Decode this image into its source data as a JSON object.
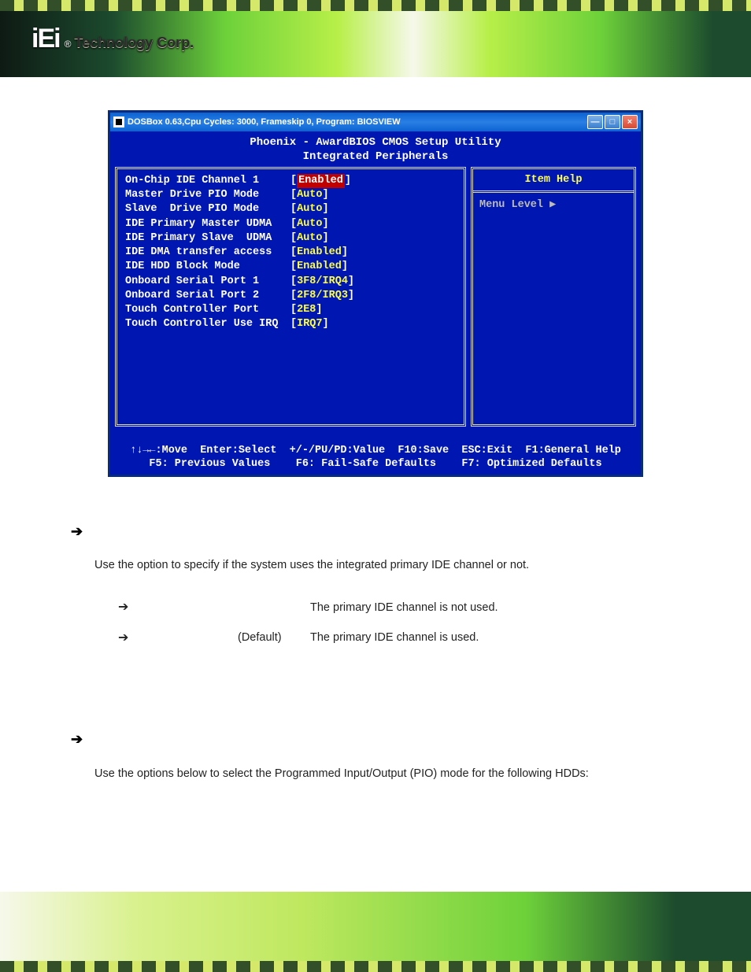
{
  "header": {
    "logo_text": "iEi",
    "logo_r": "®",
    "logo_tagline": "Technology Corp."
  },
  "dosbox": {
    "title": "DOSBox 0.63,Cpu Cycles:   3000, Frameskip 0, Program: BIOSVIEW",
    "min_glyph": "—",
    "max_glyph": "□",
    "close_glyph": "×",
    "bios_title_1": "Phoenix - AwardBIOS CMOS Setup Utility",
    "bios_title_2": "Integrated Peripherals",
    "rows": [
      {
        "label": "On-Chip IDE Channel 1",
        "value": "Enabled",
        "selected": true
      },
      {
        "label": "Master Drive PIO Mode",
        "value": "Auto"
      },
      {
        "label": "Slave  Drive PIO Mode",
        "value": "Auto"
      },
      {
        "label": "IDE Primary Master UDMA",
        "value": "Auto"
      },
      {
        "label": "IDE Primary Slave  UDMA",
        "value": "Auto"
      },
      {
        "label": "IDE DMA transfer access",
        "value": "Enabled"
      },
      {
        "label": "IDE HDD Block Mode",
        "value": "Enabled"
      },
      {
        "label": "Onboard Serial Port 1",
        "value": "3F8/IRQ4"
      },
      {
        "label": "Onboard Serial Port 2",
        "value": "2F8/IRQ3"
      },
      {
        "label": "Touch Controller Port",
        "value": "2E8"
      },
      {
        "label": "Touch Controller Use IRQ",
        "value": "IRQ7"
      }
    ],
    "help_title": "Item Help",
    "help_body": "Menu Level   ▶",
    "footer_1": "↑↓→←:Move  Enter:Select  +/-/PU/PD:Value  F10:Save  ESC:Exit  F1:General Help",
    "footer_2": "F5: Previous Values    F6: Fail-Safe Defaults    F7: Optimized Defaults"
  },
  "body": {
    "arrow": "➔",
    "p1_a": "Use the ",
    "p1_b": " option to specify if the system uses the integrated primary IDE channel or not.",
    "opt1_default": "",
    "opt1_desc": "The primary IDE channel is not used.",
    "opt2_default": "(Default)",
    "opt2_desc": "The primary IDE channel is used.",
    "p2_a": "Use the ",
    "p2_b": " options below to select the Programmed Input/Output (PIO) mode for the following HDDs:"
  }
}
